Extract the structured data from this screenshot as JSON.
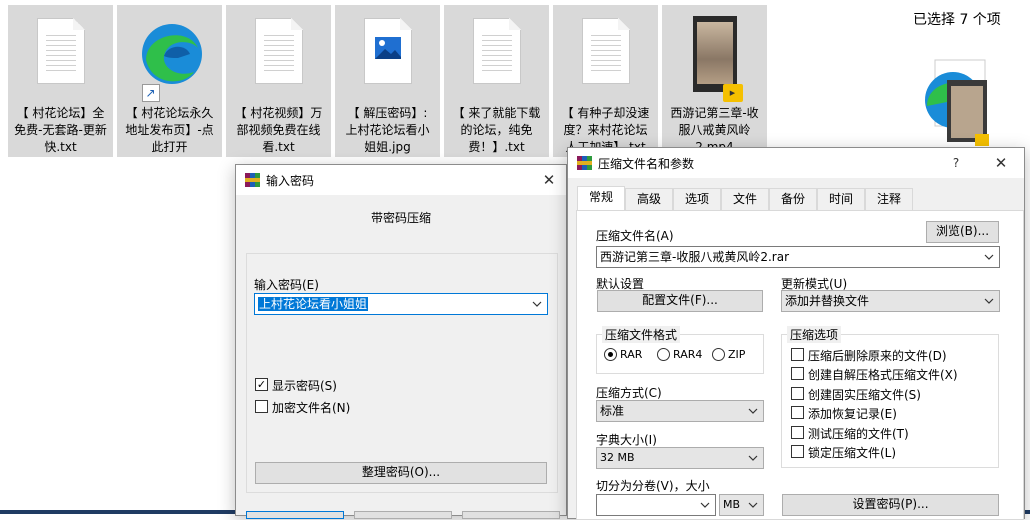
{
  "explorer": {
    "files": [
      {
        "label": "【 村花论坛】全免费-无套路-更新快.txt",
        "icon": "text-file-icon"
      },
      {
        "label": "【 村花论坛永久地址发布页】-点此打开",
        "icon": "edge-shortcut-icon"
      },
      {
        "label": "【 村花视频】万部视频免费在线看.txt",
        "icon": "text-file-icon"
      },
      {
        "label": "【 解压密码】: 上村花论坛看小姐姐.jpg",
        "icon": "image-file-icon"
      },
      {
        "label": "【 来了就能下载的论坛，纯免费！】.txt",
        "icon": "text-file-icon"
      },
      {
        "label": "【 有种子却没速度？来村花论坛人工加速】.txt",
        "icon": "text-file-icon"
      },
      {
        "label": "西游记第三章-收服八戒黄风岭2.mp4",
        "icon": "video-file-icon"
      }
    ],
    "selection_status": "已选择 7 个项"
  },
  "password_dialog": {
    "title": "输入密码",
    "subtitle": "带密码压缩",
    "password_label": "输入密码(E)",
    "password_value": "上村花论坛看小姐姐",
    "show_password_label": "显示密码(S)",
    "show_password_checked": true,
    "encrypt_names_label": "加密文件名(N)",
    "encrypt_names_checked": false,
    "organize_button": "整理密码(O)..."
  },
  "archive_dialog": {
    "title": "压缩文件名和参数",
    "help_glyph": "?",
    "close_glyph": "✕",
    "tabs": [
      "常规",
      "高级",
      "选项",
      "文件",
      "备份",
      "时间",
      "注释"
    ],
    "active_tab": "常规",
    "archive_name_label": "压缩文件名(A)",
    "browse_button": "浏览(B)...",
    "archive_name_value": "西游记第三章-收服八戒黄风岭2.rar",
    "default_settings_label": "默认设置",
    "profiles_button": "配置文件(F)...",
    "update_mode_label": "更新模式(U)",
    "update_mode_value": "添加并替换文件",
    "format_group_label": "压缩文件格式",
    "formats": [
      {
        "label": "RAR",
        "selected": true
      },
      {
        "label": "RAR4",
        "selected": false
      },
      {
        "label": "ZIP",
        "selected": false
      }
    ],
    "method_label": "压缩方式(C)",
    "method_value": "标准",
    "dict_label": "字典大小(I)",
    "dict_value": "32 MB",
    "split_label": "切分为分卷(V)，大小",
    "split_unit": "MB",
    "options_group_label": "压缩选项",
    "options": [
      {
        "label": "压缩后删除原来的文件(D)",
        "checked": false
      },
      {
        "label": "创建自解压格式压缩文件(X)",
        "checked": false
      },
      {
        "label": "创建固实压缩文件(S)",
        "checked": false
      },
      {
        "label": "添加恢复记录(E)",
        "checked": false
      },
      {
        "label": "测试压缩的文件(T)",
        "checked": false
      },
      {
        "label": "锁定压缩文件(L)",
        "checked": false
      }
    ],
    "set_password_button": "设置密码(P)..."
  }
}
